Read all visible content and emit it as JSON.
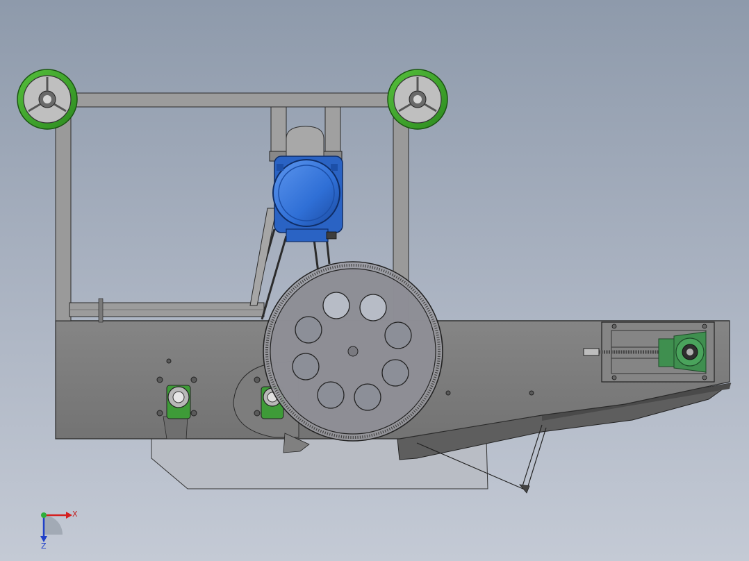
{
  "triad": {
    "x_label": "X",
    "z_label": "Z"
  },
  "colors": {
    "frame": "#8f8f8f",
    "frame_dark": "#6b6b6b",
    "plate": "#7b7b7b",
    "wheel_tire": "#3ea32a",
    "motor": "#2f6fd6",
    "bearing_housing": "#3f8f4f",
    "gear": "#8e8e94",
    "outline": "#2a2a2a"
  }
}
